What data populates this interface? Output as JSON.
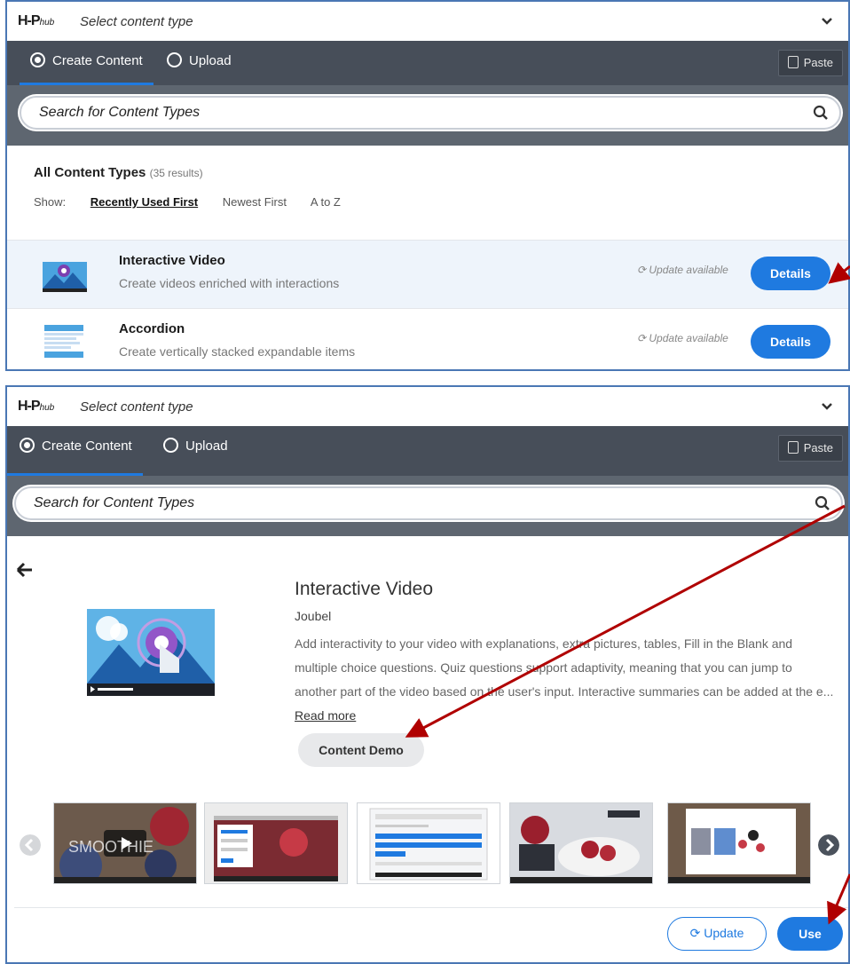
{
  "panel1": {
    "logo": "H-P",
    "logo_sub": "hub",
    "header_title": "Select content type",
    "tabs": [
      {
        "label": "Create Content",
        "selected": true
      },
      {
        "label": "Upload",
        "selected": false
      }
    ],
    "paste_label": "Paste",
    "search_placeholder": "Search for Content Types",
    "section_title": "All Content Types",
    "result_count": "(35 results)",
    "show_label": "Show:",
    "sort_options": [
      "Recently Used First",
      "Newest First",
      "A to Z"
    ],
    "items": [
      {
        "name": "Interactive Video",
        "description": "Create videos enriched with interactions",
        "status": "Update available",
        "button": "Details"
      },
      {
        "name": "Accordion",
        "description": "Create vertically stacked expandable items",
        "status": "Update available",
        "button": "Details"
      }
    ]
  },
  "panel2": {
    "logo": "H-P",
    "logo_sub": "hub",
    "header_title": "Select content type",
    "tabs": [
      {
        "label": "Create Content",
        "selected": true
      },
      {
        "label": "Upload",
        "selected": false
      }
    ],
    "paste_label": "Paste",
    "search_placeholder": "Search for Content Types",
    "detail": {
      "title": "Interactive Video",
      "author": "Joubel",
      "description": "Add interactivity to your video with explanations, extra pictures, tables, Fill in the Blank and multiple choice questions. Quiz questions support adaptivity, meaning that you can jump to another part of the video based on the user's input. Interactive summaries can be added at the e...",
      "read_more": "Read more",
      "demo_button": "Content Demo",
      "thumb_text": "SMOOTHIE"
    },
    "update_button": "Update",
    "use_button": "Use"
  },
  "colors": {
    "accent": "#1f7ae0",
    "tabbar": "#474e59",
    "searchbar": "#5e6670",
    "annotation_arrow": "#b00000"
  }
}
